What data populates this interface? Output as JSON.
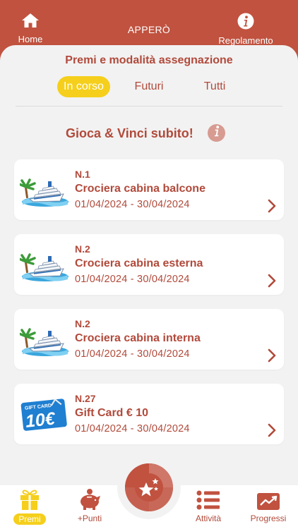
{
  "header": {
    "home_label": "Home",
    "title": "APPERÒ",
    "rules_label": "Regolamento"
  },
  "section": {
    "title": "Premi e modalità assegnazione"
  },
  "tabs": [
    {
      "label": "In corso",
      "active": true
    },
    {
      "label": "Futuri",
      "active": false
    },
    {
      "label": "Tutti",
      "active": false
    }
  ],
  "game": {
    "title": "Gioca & Vinci subito!"
  },
  "prizes": [
    {
      "count": "N.1",
      "name": "Crociera cabina balcone",
      "dates": "01/04/2024 - 30/04/2024",
      "image": "cruise-ship-icon"
    },
    {
      "count": "N.2",
      "name": "Crociera cabina esterna",
      "dates": "01/04/2024 - 30/04/2024",
      "image": "cruise-ship-icon"
    },
    {
      "count": "N.2",
      "name": "Crociera cabina interna",
      "dates": "01/04/2024 - 30/04/2024",
      "image": "cruise-ship-icon"
    },
    {
      "count": "N.27",
      "name": "Gift Card € 10",
      "dates": "01/04/2024 - 30/04/2024",
      "image": "gift-card-icon",
      "card_caption": "GIFT CARD",
      "card_value": "10€"
    }
  ],
  "nav": {
    "premi": "Premi",
    "punti": "+Punti",
    "attivita": "Attività",
    "progressi": "Progressi"
  },
  "colors": {
    "brand": "#c0523f",
    "text_accent": "#b14a3b",
    "active_yellow": "#f5cf1b",
    "background": "#f2f2f2"
  }
}
